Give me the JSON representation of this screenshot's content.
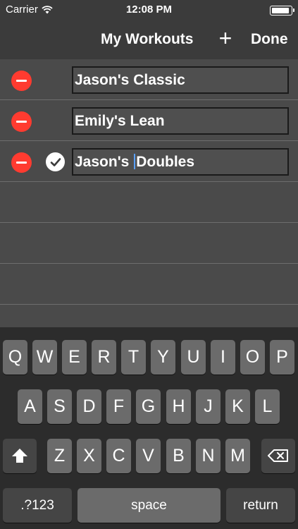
{
  "status_bar": {
    "carrier": "Carrier",
    "time": "12:08 PM",
    "battery_level": 0.95
  },
  "nav": {
    "title": "My Workouts",
    "add_label": "+",
    "done_label": "Done"
  },
  "rows": [
    {
      "name": "Jason's Classic",
      "selected": false
    },
    {
      "name": "Emily's Lean",
      "selected": false
    },
    {
      "name_before_cursor": "Jason's ",
      "name_after_cursor": "Doubles",
      "selected": true
    }
  ],
  "keyboard": {
    "row1": [
      "Q",
      "W",
      "E",
      "R",
      "T",
      "Y",
      "U",
      "I",
      "O",
      "P"
    ],
    "row2": [
      "A",
      "S",
      "D",
      "F",
      "G",
      "H",
      "J",
      "K",
      "L"
    ],
    "row3": [
      "Z",
      "X",
      "C",
      "V",
      "B",
      "N",
      "M"
    ],
    "numbers_label": ".?123",
    "space_label": "space",
    "return_label": "return"
  },
  "icons": {
    "wifi": "wifi-icon",
    "delete": "minus-circle-icon",
    "check": "checkmark-circle-icon",
    "shift": "shift-arrow-icon",
    "backspace": "backspace-icon"
  },
  "colors": {
    "delete_red": "#ff3b30",
    "cursor_blue": "#5aa0ff"
  }
}
